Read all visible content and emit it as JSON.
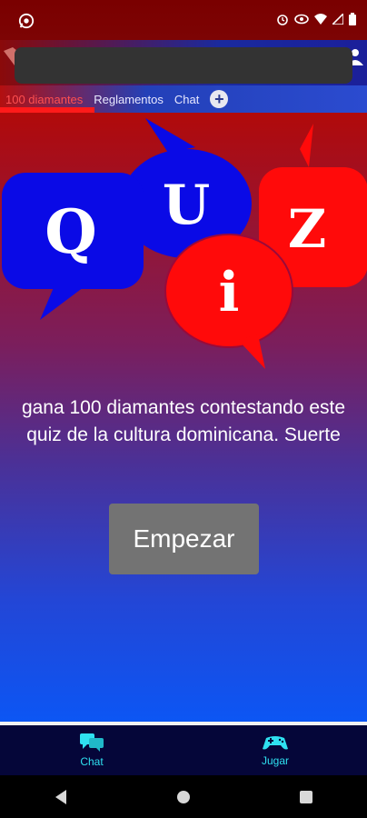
{
  "tabs": [
    {
      "label": "100 diamantes"
    },
    {
      "label": "Reglamentos"
    },
    {
      "label": "Chat"
    }
  ],
  "quiz_letters": [
    "Q",
    "U",
    "Z",
    "i"
  ],
  "main": {
    "description": "gana 100 diamantes contestando este quiz de la cultura dominicana. Suerte",
    "start_label": "Empezar"
  },
  "bottom_nav": [
    {
      "label": "Chat",
      "icon": "chat-bubbles-icon"
    },
    {
      "label": "Jugar",
      "icon": "controller-icon"
    }
  ],
  "colors": {
    "accent_cyan": "#2fe0f0",
    "bubble_blue": "#0a0ae6",
    "bubble_red": "#ff0a0a",
    "button_gray": "#737373"
  }
}
